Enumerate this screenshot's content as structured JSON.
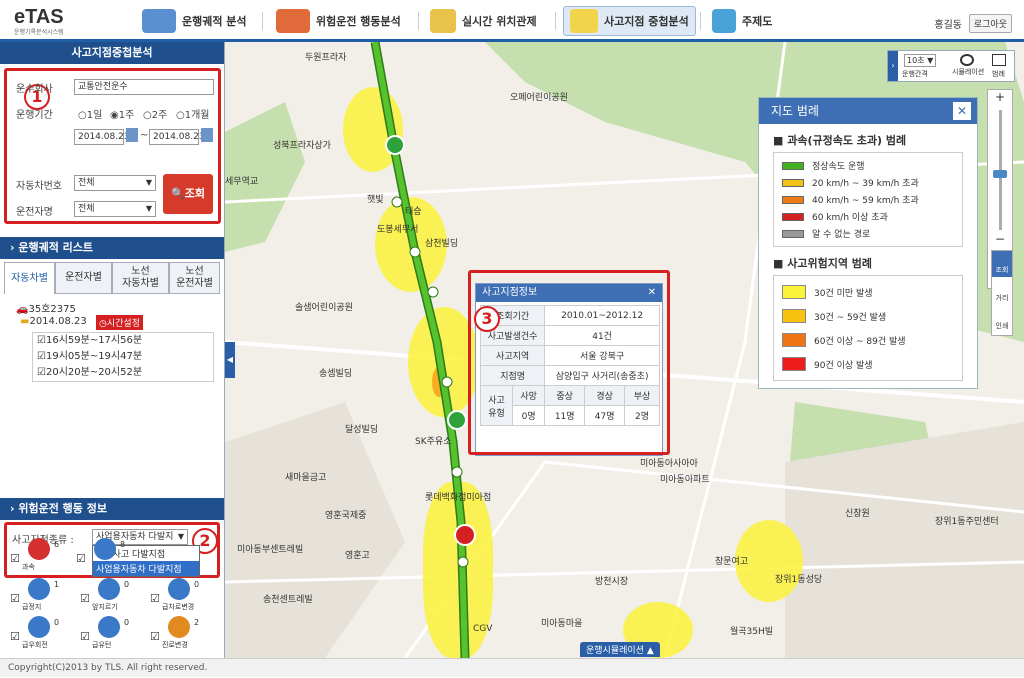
{
  "app": {
    "logo": "eTAS",
    "logo_sub": "운행기록분석시스템"
  },
  "nav": {
    "items": [
      "운행궤적 분석",
      "위험운전 행동분석",
      "실시간 위치관제",
      "사고지점 중첩분석",
      "주제도"
    ],
    "active": 3
  },
  "user": {
    "name": "홍길동",
    "logout": "로그아웃"
  },
  "left": {
    "title": "사고지점중첩분석",
    "form": {
      "company_label": "운수회사",
      "company_value": "교통안전운수",
      "period_label": "운행기간",
      "periods": [
        "1일",
        "1주",
        "2주",
        "1개월"
      ],
      "period_selected": 1,
      "date_from": "2014.08.23",
      "date_sep": "~",
      "date_to": "2014.08.23",
      "vehicle_label": "자동차번호",
      "vehicle_value": "전체",
      "driver_label": "운전자명",
      "driver_value": "전체",
      "search_label": "조회"
    },
    "marker1": "1",
    "route_title": "운행궤적 리스트",
    "tabs": [
      "자동차별",
      "운전자별",
      "노선\n자동차별",
      "노선\n운전자별"
    ],
    "tree": {
      "vehicle": "35호2375",
      "date": "2014.08.23",
      "time_btn": "시간설정",
      "items": [
        "16시59분~17시56분",
        "19시05분~19시47분",
        "20시20분~20시52분"
      ]
    },
    "risk_title": "위험운전 행동 정보",
    "risk": {
      "type_label": "사고지점종류 :",
      "type_value": "사업용자동차 다발지",
      "options": [
        "전체사고 다발지점",
        "사업용자동차 다발지점"
      ],
      "marker2": "2",
      "icons": [
        {
          "label": "과속",
          "count": "6"
        },
        {
          "label": "",
          "count": "8"
        },
        {
          "label": "급정지",
          "count": "1"
        },
        {
          "label": "앞지르기",
          "count": "0"
        },
        {
          "label": "급차로변경",
          "count": "0"
        },
        {
          "label": "급우회전",
          "count": "0"
        },
        {
          "label": "급유턴",
          "count": "0"
        },
        {
          "label": "진로변경",
          "count": "2"
        }
      ]
    }
  },
  "map": {
    "labels": [
      "두원프라자",
      "오페어린이공원",
      "성북프라자상가",
      "세무역교",
      "햇빛",
      "태승",
      "도봉세무서",
      "삼천빌딩",
      "솔샘어린이공원",
      "송셈빌딩",
      "달성빌딩",
      "SK주유소",
      "새마을금고",
      "영훈국제중",
      "영훈고",
      "미아동부센트레빌",
      "송천센트레빌",
      "방천시장",
      "미아동아파트",
      "창문여고",
      "장위1동성당",
      "월곡35H빌",
      "신창원",
      "장위1동주민센터",
      "미아동아사아아",
      "롯데백화점미아점",
      "미아동마을",
      "CGV"
    ],
    "sim_button": "운행시뮬레이션 ▲",
    "toolbar": {
      "interval": "10초",
      "interval_label": "운행간격",
      "sim_label": "시뮬레이션",
      "legend_label": "범례"
    },
    "side_tools": [
      "조회",
      "거리",
      "인쇄"
    ]
  },
  "popup": {
    "title": "사고지점정보",
    "marker": "3",
    "rows": [
      {
        "k": "조회기간",
        "v": "2010.01~2012.12"
      },
      {
        "k": "사고발생건수",
        "v": "41건"
      },
      {
        "k": "사고지역",
        "v": "서울 강북구"
      },
      {
        "k": "지점명",
        "v": "삼양입구 사거리(송중초)"
      }
    ],
    "casualty_head": [
      "사고\n유형",
      "사망",
      "중상",
      "경상",
      "부상"
    ],
    "casualty_vals": [
      "0명",
      "11명",
      "47명",
      "2명"
    ]
  },
  "legend": {
    "title": "지도 범례",
    "sec1": "과속(규정속도 초과) 범례",
    "speed": [
      {
        "c": "#44b020",
        "t": "정상속도 운행"
      },
      {
        "c": "#f3c019",
        "t": "20 km/h ~ 39 km/h 초과"
      },
      {
        "c": "#ee7a16",
        "t": "40 km/h ~ 59 km/h 초과"
      },
      {
        "c": "#d42020",
        "t": "60 km/h 이상 초과"
      },
      {
        "c": "#999999",
        "t": "알 수 없는 경로"
      }
    ],
    "sec2": "사고위험지역 범례",
    "risk": [
      {
        "c": "#fbf23a",
        "t": "30건 미만 발생"
      },
      {
        "c": "#f9c20f",
        "t": "30건 ~ 59건 발생"
      },
      {
        "c": "#f07414",
        "t": "60건 이상 ~ 89건 발생"
      },
      {
        "c": "#ee1c1c",
        "t": "90건 이상 발생"
      }
    ]
  },
  "footer": "Copyright(C)2013 by TLS. All right reserved."
}
